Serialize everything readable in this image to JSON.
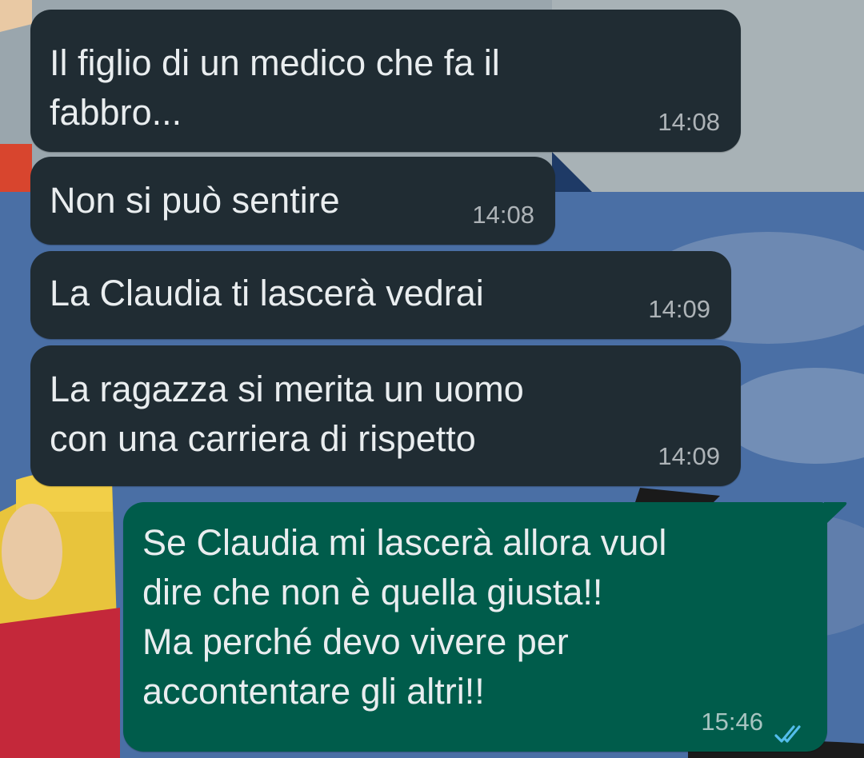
{
  "messages": [
    {
      "direction": "incoming",
      "text": "Il figlio di un medico che fa il\nfabbro...",
      "time": "14:08"
    },
    {
      "direction": "incoming",
      "text": "Non si può sentire",
      "time": "14:08"
    },
    {
      "direction": "incoming",
      "text": "La Claudia ti lascerà vedrai",
      "time": "14:09"
    },
    {
      "direction": "incoming",
      "text": "La ragazza si merita un uomo\ncon una carriera di rispetto",
      "time": "14:09"
    },
    {
      "direction": "outgoing",
      "text": "Se Claudia mi lascerà allora vuol\ndire che non è quella giusta!!\nMa perché devo vivere per\naccontentare gli altri!!",
      "time": "15:46",
      "status": "read"
    }
  ],
  "colors": {
    "incoming_bubble": "#202c33",
    "outgoing_bubble": "#005c4b",
    "read_ticks": "#53bdeb",
    "text": "#e9edef"
  },
  "icons": {
    "read_receipt": "double-check-icon"
  }
}
